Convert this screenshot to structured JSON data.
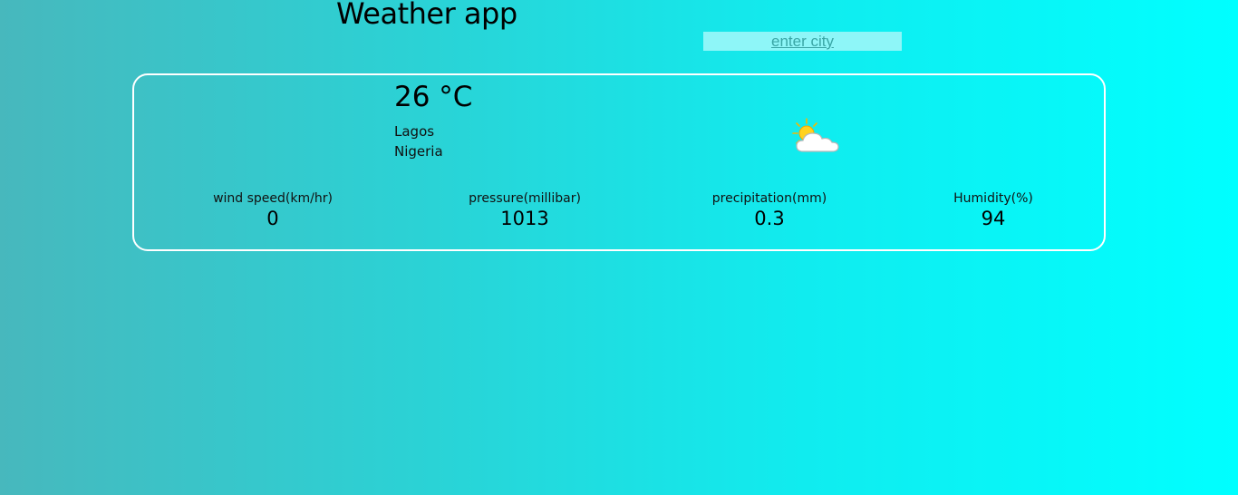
{
  "header": {
    "title": "Weather app"
  },
  "search": {
    "placeholder": "enter city"
  },
  "current": {
    "temperature": "26 °C",
    "city": "Lagos",
    "country": "Nigeria",
    "condition_icon": "partly-cloudy-icon"
  },
  "stats": [
    {
      "label": "wind speed(km/hr)",
      "value": "0"
    },
    {
      "label": "pressure(millibar)",
      "value": "1013"
    },
    {
      "label": "precipitation(mm)",
      "value": "0.3"
    },
    {
      "label": "Humidity(%)",
      "value": "94"
    }
  ],
  "colors": {
    "background_start": "#47b8bd",
    "background_end": "#00ffff",
    "card_border": "#ffffff",
    "input_background": "#8ef6f8",
    "sun": "#ffd21f",
    "cloud": "#ffffff"
  }
}
